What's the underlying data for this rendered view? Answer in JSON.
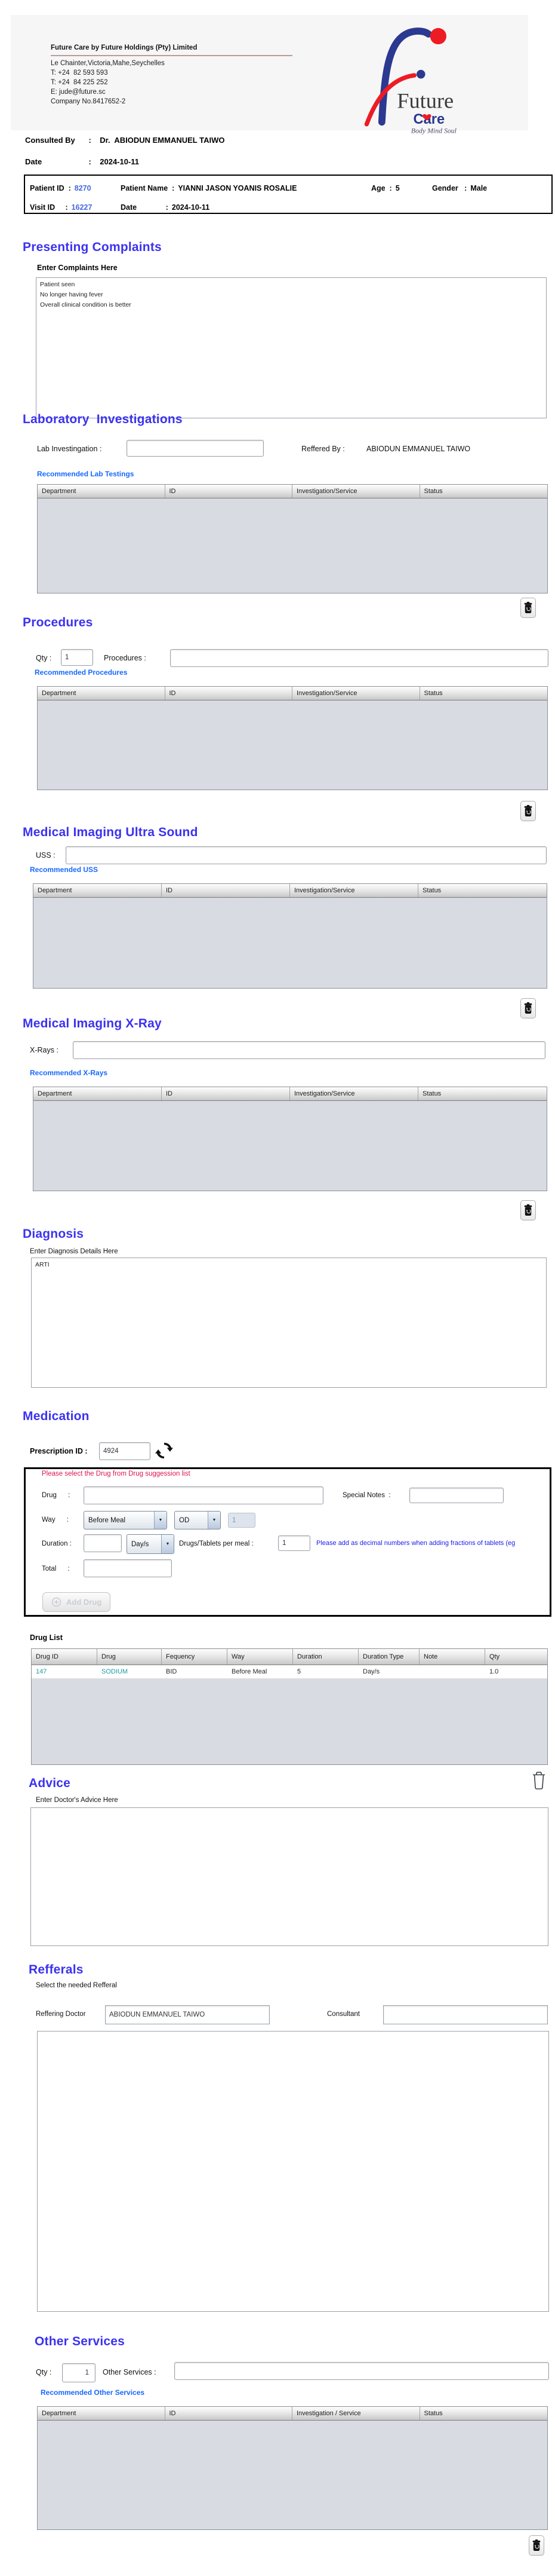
{
  "company": {
    "title": "Future Care by Future Holdings (Pty) Limited",
    "lines": [
      "Le Chainter,Victoria,Mahe,Seychelles",
      "T: +24  82 593 593",
      "T: +24  84 225 252",
      "E: jude@future.sc",
      "Company No.8417652-2"
    ],
    "logo_future": "Future",
    "logo_care": "Care",
    "logo_tagline": "Body Mind Soul"
  },
  "consult": {
    "label": "Consulted By",
    "colon": ":",
    "doctor": "Dr.  ABIODUN EMMANUEL TAIWO",
    "date_label": "Date",
    "date": "2024-10-11"
  },
  "patient": {
    "patient_id_label": "Patient ID  :",
    "patient_id": "8270",
    "name_label": "Patient Name  :",
    "name": "YIANNI JASON YOANIS ROSALIE",
    "age_label": "Age  :",
    "age": "5",
    "gender_label": "Gender   :",
    "gender": "Male",
    "visit_label": "Visit ID     :",
    "visit_id": "16227",
    "date_label": "Date              :",
    "date": "2024-10-11"
  },
  "complaints": {
    "title": "Presenting Complaints",
    "label": "Enter Complaints Here",
    "text": "Patient seen\nNo longer having fever\nOverall clinical condition is better"
  },
  "lab": {
    "title": "Laboratory  Investigations",
    "input_label": "Lab Investingation :",
    "input_value": "",
    "referred_label": "Reffered By :",
    "referred_value": "ABIODUN EMMANUEL TAIWO",
    "recommended": "Recommended Lab Testings",
    "headers": [
      "Department",
      "ID",
      "Investigation/Service",
      "Status"
    ]
  },
  "procedures": {
    "title": "Procedures",
    "qty_label": "Qty :",
    "qty_value": "1",
    "input_label": "Procedures :",
    "input_value": "",
    "recommended": "Recommended Procedures",
    "headers": [
      "Department",
      "ID",
      "Investigation/Service",
      "Status"
    ]
  },
  "uss": {
    "title": "Medical Imaging Ultra Sound",
    "input_label": "USS :",
    "input_value": "",
    "recommended": "Recommended USS",
    "headers": [
      "Department",
      "ID",
      "Investigation/Service",
      "Status"
    ]
  },
  "xray": {
    "title": "Medical Imaging X-Ray",
    "input_label": "X-Rays :",
    "input_value": "",
    "recommended": "Recommended X-Rays",
    "headers": [
      "Department",
      "ID",
      "Investigation/Service",
      "Status"
    ]
  },
  "diagnosis": {
    "title": "Diagnosis",
    "label": "Enter Diagnosis Details Here",
    "text": "ARTI"
  },
  "medication": {
    "title": "Medication",
    "prescription_label": "Prescription ID :",
    "prescription_id": "4924",
    "suggestion_note": "Please select the Drug from Drug suggession list",
    "drug_label": "Drug      :",
    "drug_value": "",
    "special_notes_label": "Special Notes  :",
    "special_notes_value": "",
    "way_label": "Way      :",
    "way_value": "Before Meal",
    "freq_value": "OD",
    "freq_qty": "1",
    "duration_label": "Duration :",
    "duration_value": "",
    "duration_type": "Day/s",
    "per_meal_label": "Drugs/Tablets per meal :",
    "per_meal_value": "1",
    "decimal_note": "Please add as decimal numbers when adding fractions of tablets (eg",
    "total_label": "Total      :",
    "total_value": "",
    "add_drug_label": "Add Drug",
    "drug_list_label": "Drug List",
    "headers": [
      "Drug ID",
      "Drug",
      "Fequency",
      "Way",
      "Duration",
      "Duration Type",
      "Note",
      "Qty"
    ],
    "rows": [
      {
        "drug_id": "147",
        "drug": "SODIUM",
        "frequency": "BID",
        "way": "Before Meal",
        "duration": "5",
        "duration_type": "Day/s",
        "note": "",
        "qty": "1.0"
      }
    ]
  },
  "advice": {
    "title": "Advice",
    "label": "Enter Doctor's Advice Here",
    "text": ""
  },
  "referrals": {
    "title": "Refferals",
    "label": "Select the needed Refferal",
    "doctor_label": "Reffering Doctor",
    "doctor_value": "ABIODUN EMMANUEL TAIWO",
    "consultant_label": "Consultant",
    "consultant_value": ""
  },
  "other": {
    "title": "Other Services",
    "qty_label": "Qty :",
    "qty_value": "1",
    "input_label": "Other Services :",
    "input_value": "",
    "recommended": "Recommended Other Services",
    "headers": [
      "Department",
      "ID",
      "Investigation / Service",
      "Status"
    ]
  },
  "icons": {
    "chevron": "▼"
  },
  "colors": {
    "heading_blue": "#3b32f0",
    "link_blue": "#1668ff",
    "id_blue": "#4468e0",
    "alert_red": "#dd1450",
    "note_blue": "#1a1aee",
    "drug_teal": "#1f9aa3",
    "logo_blue": "#2b3990",
    "logo_red": "#ed1c24"
  }
}
